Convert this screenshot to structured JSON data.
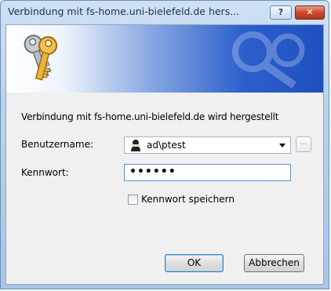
{
  "window": {
    "title": "Verbindung mit fs-home.uni-bielefeld.de hers...",
    "help_label": "?",
    "close_label": "✕"
  },
  "dialog": {
    "message": "Verbindung mit fs-home.uni-bielefeld.de wird hergestellt",
    "username_label": "Benutzername:",
    "username_value": "ad\\ptest",
    "browse_label": "...",
    "password_label": "Kennwort:",
    "password_value": "••••••",
    "remember_label": "Kennwort speichern",
    "remember_checked": false,
    "ok_label": "OK",
    "cancel_label": "Abbrechen"
  },
  "icons": {
    "banner": "keys-icon",
    "user": "user-icon",
    "dropdown": "chevron-down-icon"
  },
  "colors": {
    "banner_blue": "#2c5fcc",
    "close_red": "#c9452b",
    "focus_border": "#5f8fd0"
  }
}
